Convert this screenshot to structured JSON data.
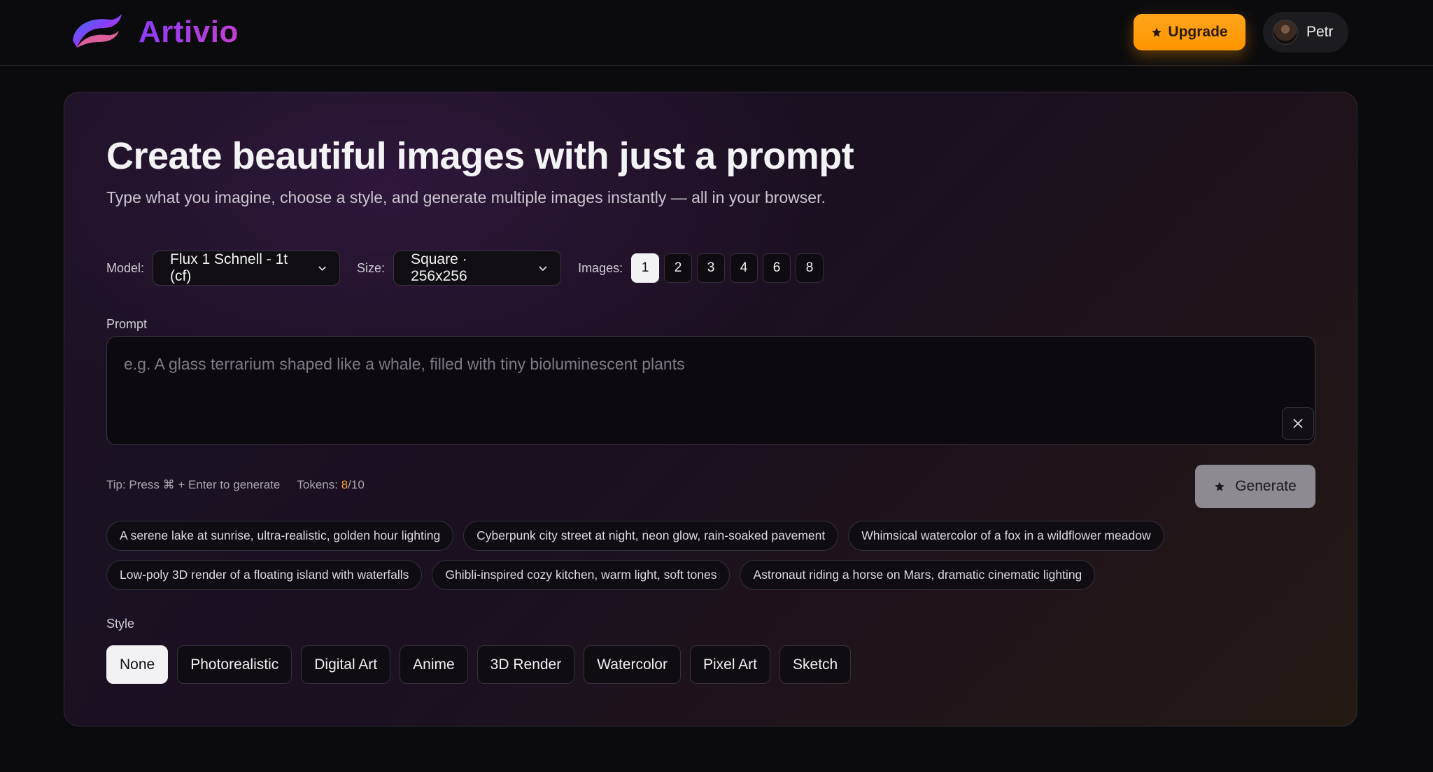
{
  "app": {
    "brand": "Artivio"
  },
  "header": {
    "upgrade_label": "Upgrade",
    "user_name": "Petr"
  },
  "hero": {
    "title": "Create beautiful images with just a prompt",
    "subtitle": "Type what you imagine, choose a style, and generate multiple images instantly — all in your browser."
  },
  "controls": {
    "model_label": "Model:",
    "model_value": "Flux 1 Schnell - 1t (cf)",
    "size_label": "Size:",
    "size_value": "Square · 256x256",
    "images_label": "Images:",
    "image_counts": [
      "1",
      "2",
      "3",
      "4",
      "6",
      "8"
    ],
    "image_count_selected": "1"
  },
  "prompt": {
    "label": "Prompt",
    "placeholder": "e.g. A glass terrarium shaped like a whale, filled with tiny bioluminescent plants",
    "value": ""
  },
  "footer_row": {
    "tip": "Tip: Press ⌘ + Enter to generate",
    "tokens_label": "Tokens:",
    "tokens_used": "8",
    "tokens_total": "/10",
    "generate_label": "Generate"
  },
  "suggestions": [
    "A serene lake at sunrise, ultra-realistic, golden hour lighting",
    "Cyberpunk city street at night, neon glow, rain-soaked pavement",
    "Whimsical watercolor of a fox in a wildflower meadow",
    "Low-poly 3D render of a floating island with waterfalls",
    "Ghibli-inspired cozy kitchen, warm light, soft tones",
    "Astronaut riding a horse on Mars, dramatic cinematic lighting"
  ],
  "style": {
    "label": "Style",
    "options": [
      "None",
      "Photorealistic",
      "Digital Art",
      "Anime",
      "3D Render",
      "Watercolor",
      "Pixel Art",
      "Sketch"
    ],
    "selected": "None"
  },
  "colors": {
    "accent_orange": "#ff9500",
    "brand_purple": "#8b3cf7",
    "background": "#0b0b0d"
  }
}
